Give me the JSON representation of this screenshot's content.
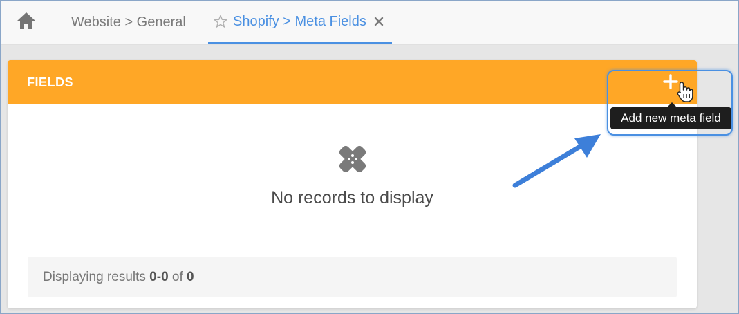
{
  "tabs": {
    "home_icon": "home-icon",
    "general_label": "Website > General",
    "active_label": "Shopify > Meta Fields",
    "active_star_icon": "star-outline-icon",
    "active_close_icon": "close-icon"
  },
  "panel": {
    "title": "FIELDS",
    "add_icon": "plus-icon",
    "header_color": "#ffa726",
    "empty_icon": "bandage-icon",
    "empty_text": "No records to display"
  },
  "pager": {
    "prefix": "Displaying results ",
    "range": "0-0",
    "of_label": " of ",
    "total": "0"
  },
  "tooltip": {
    "text": "Add new meta field"
  },
  "colors": {
    "accent": "#4a90e2",
    "header": "#ffa726"
  }
}
